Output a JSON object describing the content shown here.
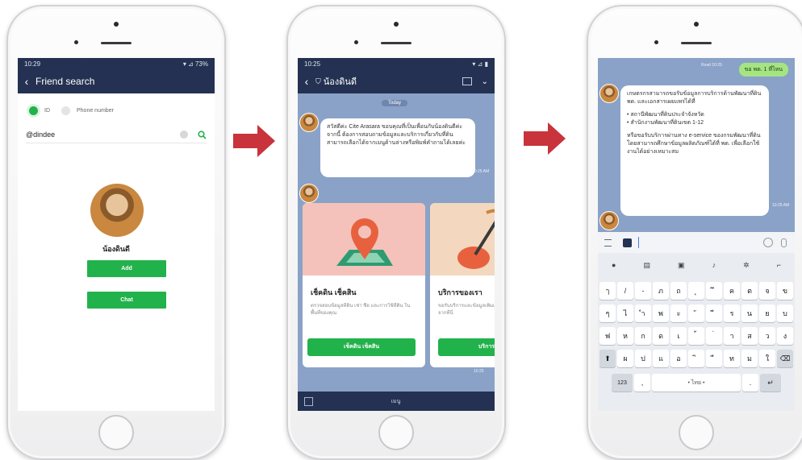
{
  "screen1": {
    "status_time": "10:29",
    "status_right": "▾ ⊿ 73%",
    "header_title": "Friend search",
    "radio_id": "ID",
    "radio_phone": "Phone number",
    "search_value": "@dindee",
    "profile_name": "น้องดินดี",
    "add_label": "Add",
    "chat_label": "Chat"
  },
  "screen2": {
    "status_time": "10:25",
    "header_title": "น้องดินดี",
    "date_badge": "Today",
    "welcome_message": "สวัสดีค่ะ Cite Arasara ขอบคุณที่เป็นเพื่อนกับน้องดินดีค่ะ จากนี้ ต้องการสอบถามข้อมูลและบริการเกี่ยวกับที่ดิน สามารถเลือกได้จากเมนูด้านล่างหรือพิมพ์คำถามได้เลยค่ะ",
    "card1_title": "เช็คดิน เช็คสิน",
    "card1_desc": "ตรวจสอบข้อมูลที่ดิน เช่า ซื้อ และการใช้ที่ดิน ในพื้นที่ของคุณ",
    "card1_button": "เช็คดิน เช็คสิน",
    "card2_title": "บริการของเรา",
    "card2_desc": "ขอรับบริการและข้อมูลเพิ่มเติมได้จากที่นี่",
    "card2_button": "บริการ",
    "menu_label": "เมนู"
  },
  "screen3": {
    "sent_message": "ขอ พด. 1 ที่ไหน",
    "reply_line1": "เกษตรกรสามารถขอรับข้อมูลการบริการด้านพัฒนาที่ดิน พด. และเอกสารเผยแพร่ได้ที่",
    "reply_bullet1": "• สถานีพัฒนาที่ดินประจำจังหวัด",
    "reply_bullet2": "• สำนักงานพัฒนาที่ดินเขต 1-12",
    "reply_line2": "หรือขอรับบริการผ่านทาง e-service ของกรมพัฒนาที่ดิน โดยสามารถศึกษาข้อมูลผลิตภัณฑ์ได้ที่ พด. เพื่อเลือกใช้งานได้อย่างเหมาะสม",
    "space_label": "• ไทย •",
    "num_key": "123",
    "keyboard_rows": [
      [
        "ๅ",
        "/",
        "-",
        "ภ",
        "ถ",
        "ุ",
        "ึ",
        "ค",
        "ต",
        "จ",
        "ข"
      ],
      [
        "ๆ",
        "ไ",
        "ำ",
        "พ",
        "ะ",
        "ั",
        "ี",
        "ร",
        "น",
        "ย",
        "บ"
      ],
      [
        "ฟ",
        "ห",
        "ก",
        "ด",
        "เ",
        "้",
        "่",
        "า",
        "ส",
        "ว",
        "ง"
      ],
      [
        "ผ",
        "ป",
        "แ",
        "อ",
        "ิ",
        "ื",
        "ท",
        "ม",
        "ใ"
      ]
    ]
  },
  "colors": {
    "navy": "#243152",
    "line_green": "#22b24c",
    "chat_blue": "#8aa2c7",
    "arrow_red": "#c9333b"
  }
}
